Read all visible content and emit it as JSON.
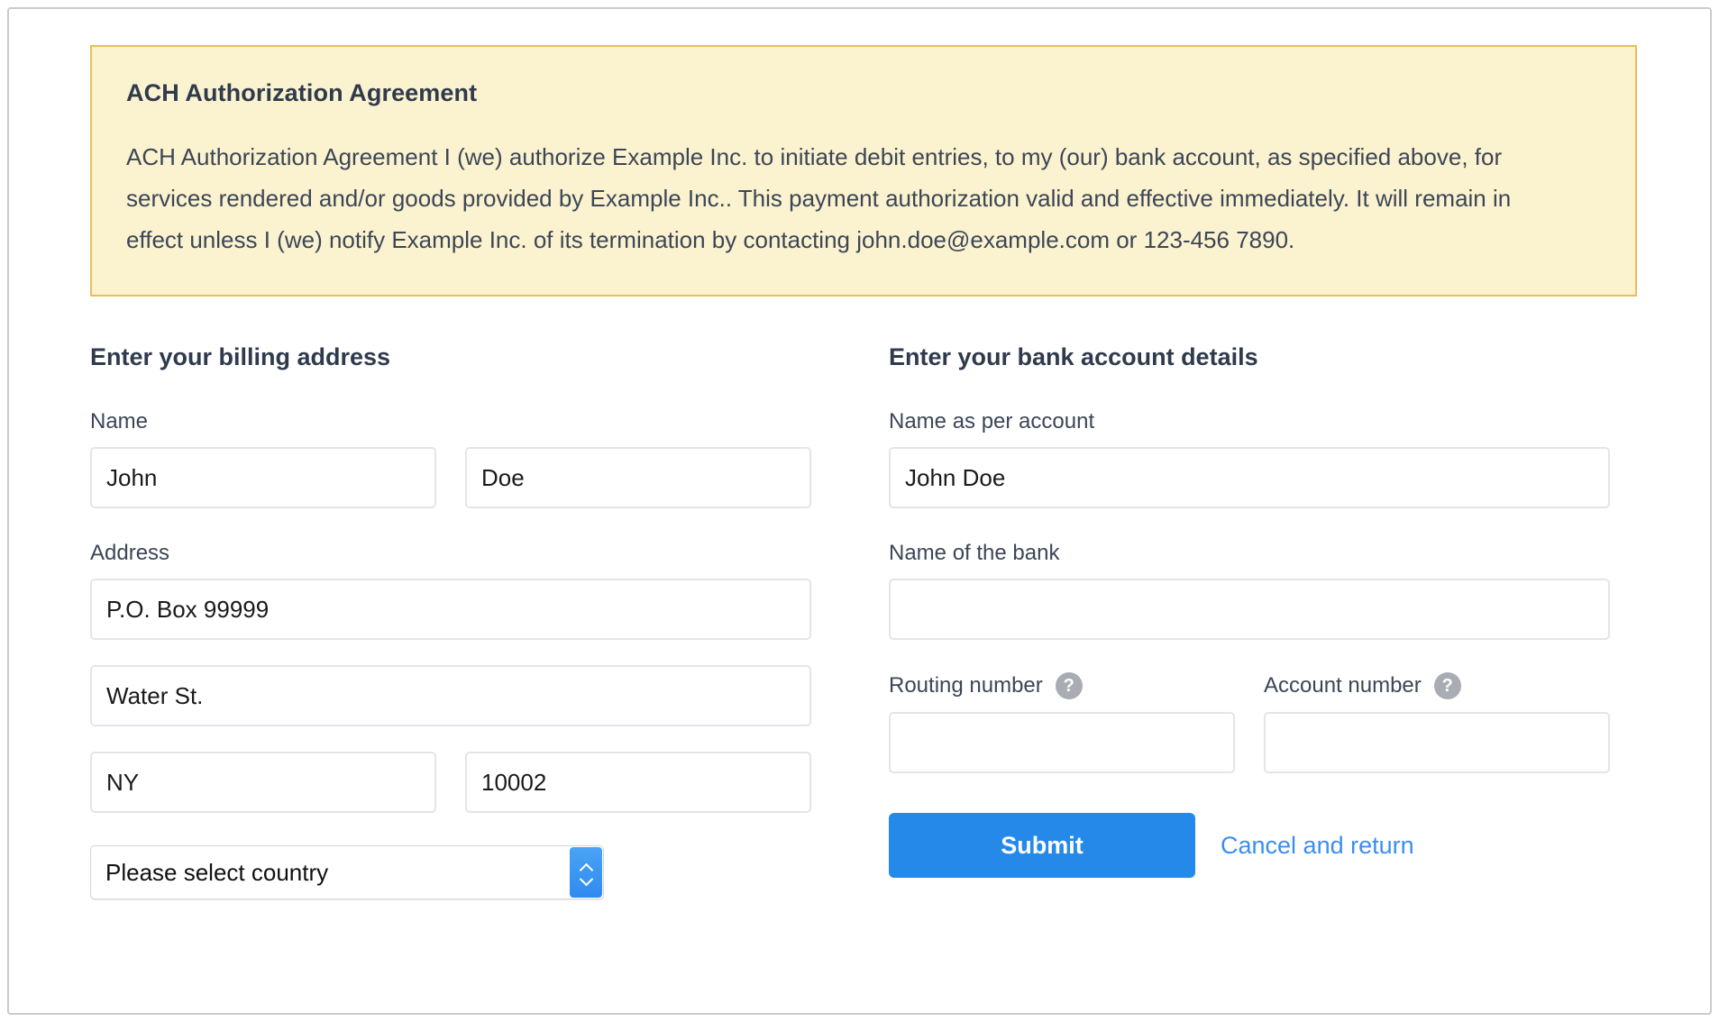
{
  "notice": {
    "title": "ACH Authorization Agreement",
    "body": "ACH Authorization Agreement I (we) authorize Example Inc. to initiate debit entries, to my (our) bank account, as specified above, for services rendered and/or goods provided by Example Inc.. This payment authorization valid and effective immediately. It will remain in effect unless I (we) notify Example Inc. of its termination by contacting john.doe@example.com or 123-456 7890.",
    "border_color": "#e4c157",
    "background_color": "#fbf2cf"
  },
  "billing": {
    "heading": "Enter your billing address",
    "name_label": "Name",
    "first_name": "John",
    "last_name": "Doe",
    "first_name_placeholder": "",
    "last_name_placeholder": "",
    "address_label": "Address",
    "address_line1": "P.O. Box 99999",
    "address_line2": "Water St.",
    "city_state": "NY",
    "zip": "10002",
    "country_selected": "Please select country"
  },
  "bank": {
    "heading": "Enter your bank account details",
    "account_name_label": "Name as per account",
    "account_name": "John Doe",
    "bank_name_label": "Name of the bank",
    "bank_name": "",
    "routing_label": "Routing number",
    "routing_number": "",
    "routing_help_icon": "question-mark-icon",
    "account_number_label": "Account number",
    "account_number": "",
    "account_help_icon": "question-mark-icon",
    "help_glyph": "?"
  },
  "actions": {
    "submit_label": "Submit",
    "cancel_label": "Cancel and return",
    "submit_color": "#2489e8",
    "cancel_color": "#3b8ef0"
  },
  "select_control": {
    "up_arrow": "chevron-up",
    "down_arrow": "chevron-down",
    "accent_color": "#2f8bef"
  }
}
